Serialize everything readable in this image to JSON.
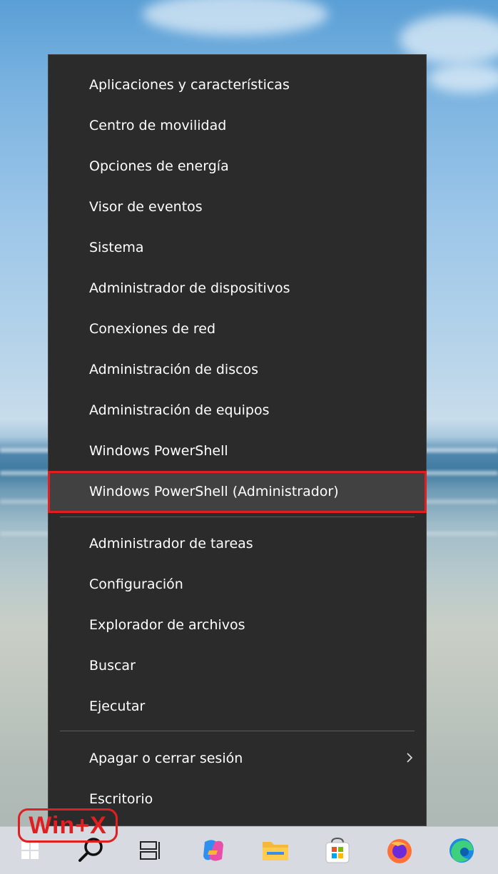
{
  "menu": {
    "items": [
      {
        "label": "Aplicaciones y características"
      },
      {
        "label": "Centro de movilidad"
      },
      {
        "label": "Opciones de energía"
      },
      {
        "label": "Visor de eventos"
      },
      {
        "label": "Sistema"
      },
      {
        "label": "Administrador de dispositivos"
      },
      {
        "label": "Conexiones de red"
      },
      {
        "label": "Administración de discos"
      },
      {
        "label": "Administración de equipos"
      },
      {
        "label": "Windows PowerShell"
      },
      {
        "label": "Windows PowerShell (Administrador)",
        "highlighted": true
      },
      {
        "label": "Administrador de tareas"
      },
      {
        "label": "Configuración"
      },
      {
        "label": "Explorador de archivos"
      },
      {
        "label": "Buscar"
      },
      {
        "label": "Ejecutar"
      },
      {
        "label": "Apagar o cerrar sesión",
        "submenu": true
      },
      {
        "label": "Escritorio"
      }
    ]
  },
  "annotation": {
    "shortcut_label": "Win+X",
    "color": "#e02020"
  },
  "taskbar": {
    "icons": [
      "windows-start-icon",
      "search-icon",
      "task-view-icon",
      "copilot-icon",
      "file-explorer-icon",
      "microsoft-store-icon",
      "firefox-icon",
      "edge-icon"
    ]
  },
  "colors": {
    "menu_bg": "#2b2b2b",
    "highlight_bg": "#414141",
    "highlight_border": "#e02020",
    "taskbar_bg": "#d7dbe1"
  }
}
